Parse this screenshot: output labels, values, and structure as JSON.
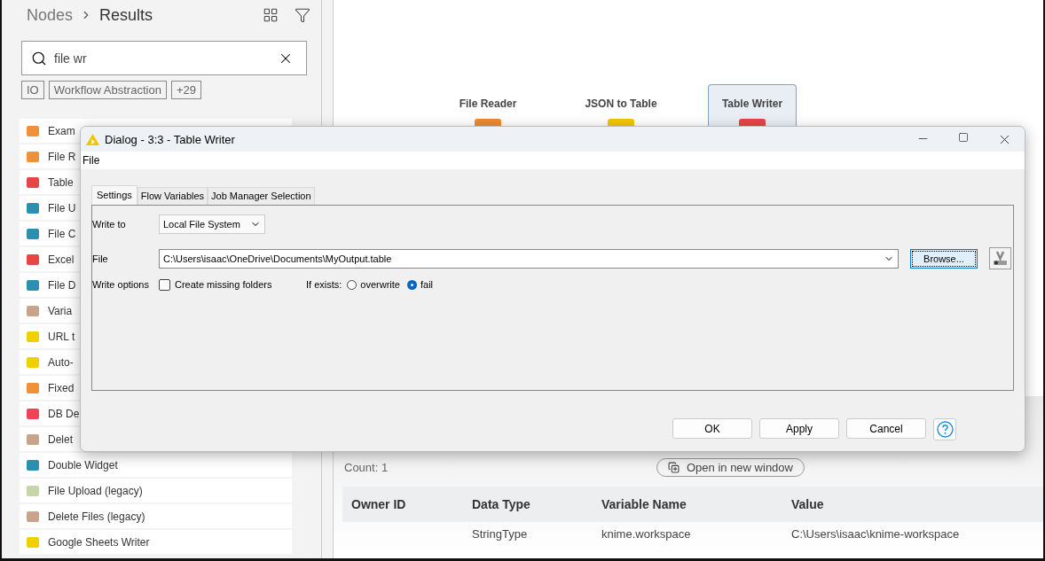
{
  "sidebar": {
    "breadcrumb": [
      "Nodes",
      "Results"
    ],
    "search": {
      "value": "file wr"
    },
    "tags": [
      "IO",
      "Workflow Abstraction",
      "+29"
    ],
    "items": [
      {
        "label": "Exam",
        "color": "#f0913a"
      },
      {
        "label": "File R",
        "color": "#f0913a"
      },
      {
        "label": "Table",
        "color": "#e84545"
      },
      {
        "label": "File U",
        "color": "#2b8fb0"
      },
      {
        "label": "File C",
        "color": "#2b8fb0"
      },
      {
        "label": "Excel",
        "color": "#e84545"
      },
      {
        "label": "File D",
        "color": "#2b8fb0"
      },
      {
        "label": "Varia",
        "color": "#c9a48a"
      },
      {
        "label": "URL t",
        "color": "#f0d000"
      },
      {
        "label": "Auto-",
        "color": "#f0d000"
      },
      {
        "label": "Fixed",
        "color": "#f0913a"
      },
      {
        "label": "DB De",
        "color": "#ee4455"
      },
      {
        "label": "Delet",
        "color": "#c9a48a"
      },
      {
        "label": "Double Widget",
        "color": "#2b8fb0"
      },
      {
        "label": "File Upload (legacy)",
        "color": "#c6d6a8"
      },
      {
        "label": "Delete Files (legacy)",
        "color": "#c9a48a"
      },
      {
        "label": "Google Sheets Writer",
        "color": "#f0d000"
      }
    ]
  },
  "canvas": {
    "nodes": [
      {
        "label": "File Reader",
        "color": "#ef8a2f",
        "selected": false
      },
      {
        "label": "JSON to Table",
        "color": "#f0c800",
        "selected": false
      },
      {
        "label": "Table Writer",
        "color": "#e84545",
        "selected": true
      }
    ]
  },
  "bottom_panel": {
    "count": "Count: 1",
    "open_button": "Open in new window",
    "table": {
      "columns": [
        "Owner ID",
        "Data Type",
        "Variable Name",
        "Value"
      ],
      "rows": [
        {
          "data_type": "StringType",
          "variable_name": "knime.workspace",
          "value": "C:\\Users\\isaac\\knime-workspace"
        }
      ]
    }
  },
  "dialog": {
    "title": "Dialog - 3:3 - Table Writer",
    "menu": [
      "File"
    ],
    "tabs": [
      {
        "label": "Settings",
        "selected": true
      },
      {
        "label": "Flow Variables",
        "selected": false
      },
      {
        "label": "Job Manager Selection",
        "selected": false
      }
    ],
    "write_to": {
      "label": "Write to",
      "value": "Local File System"
    },
    "file": {
      "label": "File",
      "value": "C:\\Users\\isaac\\OneDrive\\Documents\\MyOutput.table",
      "browse": "Browse..."
    },
    "write_options": {
      "label": "Write options",
      "create_missing_folders": {
        "label": "Create missing folders",
        "checked": false
      },
      "if_exists": {
        "label": "If exists:",
        "options": [
          {
            "label": "overwrite",
            "selected": false
          },
          {
            "label": "fail",
            "selected": true
          }
        ]
      }
    },
    "buttons": [
      "OK",
      "Apply",
      "Cancel"
    ]
  }
}
